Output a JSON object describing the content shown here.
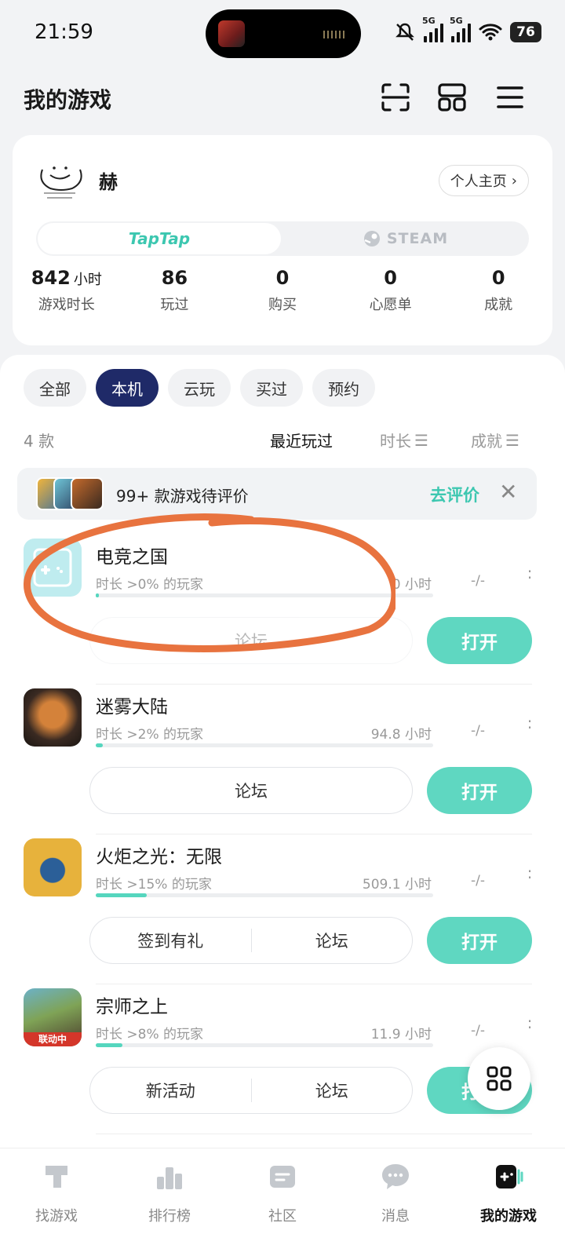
{
  "status_bar": {
    "time": "21:59",
    "signal_label": "5G",
    "battery": "76"
  },
  "header": {
    "title": "我的游戏",
    "icons": [
      "scan-icon",
      "layout-grid-icon",
      "menu-icon"
    ]
  },
  "profile": {
    "username": "赫",
    "home_button": "个人主页",
    "platform_tabs": [
      "TapTap",
      "STEAM"
    ],
    "active_platform": "TapTap",
    "stats": [
      {
        "value": "842",
        "unit": "小时",
        "label": "游戏时长"
      },
      {
        "value": "86",
        "unit": "",
        "label": "玩过"
      },
      {
        "value": "0",
        "unit": "",
        "label": "购买"
      },
      {
        "value": "0",
        "unit": "",
        "label": "心愿单"
      },
      {
        "value": "0",
        "unit": "",
        "label": "成就"
      }
    ]
  },
  "filters": [
    "全部",
    "本机",
    "云玩",
    "买过",
    "预约"
  ],
  "active_filter": "本机",
  "list": {
    "count": "4 款",
    "sort_options": [
      "最近玩过",
      "时长",
      "成就"
    ],
    "active_sort": "最近玩过"
  },
  "rating_banner": {
    "text": "99+ 款游戏待评价",
    "action": "去评价"
  },
  "games": [
    {
      "name": "电竞之国",
      "percentile": "时长 >0% 的玩家",
      "hours": "0 小时",
      "score": "-/-",
      "progress": 0.01,
      "actions": [
        "论坛"
      ],
      "open": "打开"
    },
    {
      "name": "迷雾大陆",
      "percentile": "时长 >2% 的玩家",
      "hours": "94.8 小时",
      "score": "-/-",
      "progress": 0.02,
      "actions": [
        "论坛"
      ],
      "open": "打开"
    },
    {
      "name": "火炬之光：无限",
      "percentile": "时长 >15% 的玩家",
      "hours": "509.1 小时",
      "score": "-/-",
      "progress": 0.15,
      "actions": [
        "签到有礼",
        "论坛"
      ],
      "open": "打开"
    },
    {
      "name": "宗师之上",
      "percentile": "时长 >8% 的玩家",
      "hours": "11.9 小时",
      "score": "-/-",
      "progress": 0.08,
      "actions": [
        "新活动",
        "论坛"
      ],
      "open": "打开",
      "badge": "联动中"
    }
  ],
  "bottom_nav": [
    {
      "label": "找游戏",
      "icon": "find-games-icon"
    },
    {
      "label": "排行榜",
      "icon": "ranking-icon"
    },
    {
      "label": "社区",
      "icon": "community-icon"
    },
    {
      "label": "消息",
      "icon": "message-icon"
    },
    {
      "label": "我的游戏",
      "icon": "my-games-icon"
    }
  ],
  "active_nav": "我的游戏",
  "colors": {
    "accent": "#5fd7c1",
    "active_filter": "#1f2a68",
    "annotation": "#e8733f"
  }
}
